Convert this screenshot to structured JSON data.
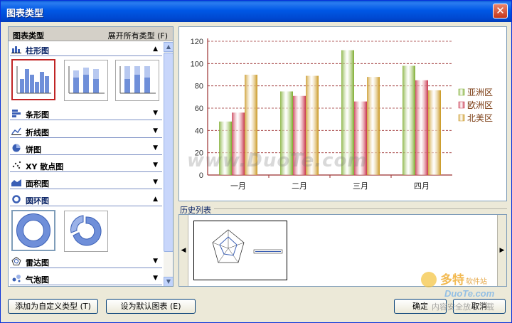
{
  "window": {
    "title": "图表类型",
    "close_symbol": "✕"
  },
  "gallery": {
    "header_label": "图表类型",
    "expand_label": "展开所有类型 (F)",
    "categories": [
      {
        "label": "柱形图",
        "icon": "column-chart-icon",
        "state": "expanded"
      },
      {
        "label": "条形图",
        "icon": "bar-chart-icon",
        "state": "collapsed"
      },
      {
        "label": "折线图",
        "icon": "line-chart-icon",
        "state": "collapsed"
      },
      {
        "label": "饼图",
        "icon": "pie-chart-icon",
        "state": "collapsed"
      },
      {
        "label": "XY 散点图",
        "icon": "scatter-chart-icon",
        "state": "collapsed"
      },
      {
        "label": "面积图",
        "icon": "area-chart-icon",
        "state": "collapsed"
      },
      {
        "label": "圆环图",
        "icon": "doughnut-chart-icon",
        "state": "expanded"
      },
      {
        "label": "雷达图",
        "icon": "radar-chart-icon",
        "state": "collapsed"
      },
      {
        "label": "气泡图",
        "icon": "bubble-chart-icon",
        "state": "collapsed"
      }
    ],
    "arrows": {
      "up": "▲",
      "down": "▼"
    }
  },
  "history": {
    "label": "历史列表",
    "left": "◀",
    "right": "▶"
  },
  "buttons": {
    "add_custom": "添加为自定义类型 (T)",
    "set_default": "设为默认图表 (E)",
    "ok": "确定",
    "cancel": "取消"
  },
  "watermark_text": "www.DuoTe.com",
  "logo": {
    "main": "多特",
    "sub": "软件站",
    "url": "DuoTe.com",
    "tag": "内容安全放心下载"
  },
  "chart_data": {
    "type": "bar",
    "categories": [
      "一月",
      "二月",
      "三月",
      "四月"
    ],
    "series": [
      {
        "name": "亚洲区",
        "values": [
          48,
          75,
          112,
          98
        ],
        "color": "#7cab2d"
      },
      {
        "name": "欧洲区",
        "values": [
          56,
          71,
          66,
          85
        ],
        "color": "#c8354d"
      },
      {
        "name": "北美区",
        "values": [
          90,
          89,
          88,
          76
        ],
        "color": "#c9961f"
      }
    ],
    "ylim": [
      0,
      120
    ],
    "yticks": [
      0,
      20,
      40,
      60,
      80,
      100,
      120
    ],
    "grid": true,
    "legend": "right"
  }
}
